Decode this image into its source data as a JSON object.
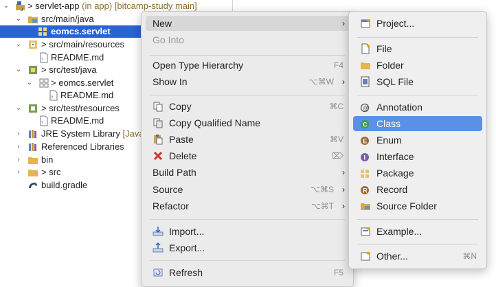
{
  "tree": {
    "project_name": "servlet-app",
    "project_suffix": " (in app) [bitcamp-study main]",
    "src_main_java": "src/main/java",
    "pkg_eomcs": "eomcs.servlet",
    "src_main_resources": "src/main/resources",
    "readme1": "README.md",
    "src_test_java": "src/test/java",
    "pkg_eomcs2": "eomcs.servlet",
    "readme2": "README.md",
    "src_test_resources": "src/test/resources",
    "readme3": "README.md",
    "jre": "JRE System Library",
    "jre_suffix": " [Java",
    "referenced": "Referenced Libraries",
    "bin": "bin",
    "src": "src",
    "gradle": "build.gradle",
    "twisty_open": "⌄",
    "twisty_closed": "›",
    "vcs_marker": ">"
  },
  "context_menu": {
    "new": "New",
    "go_into": "Go Into",
    "open_type_hierarchy": "Open Type Hierarchy",
    "open_type_hierarchy_sc": "F4",
    "show_in": "Show In",
    "show_in_sc": "⌥⌘W",
    "copy": "Copy",
    "copy_sc": "⌘C",
    "copy_qualified": "Copy Qualified Name",
    "paste": "Paste",
    "paste_sc": "⌘V",
    "delete": "Delete",
    "delete_sc": "⌦",
    "build_path": "Build Path",
    "source": "Source",
    "source_sc": "⌥⌘S",
    "refactor": "Refactor",
    "refactor_sc": "⌥⌘T",
    "import": "Import...",
    "export": "Export...",
    "refresh": "Refresh",
    "refresh_sc": "F5",
    "submenu_arrow": "›"
  },
  "new_submenu": {
    "project": "Project...",
    "file": "File",
    "folder": "Folder",
    "sql_file": "SQL File",
    "annotation": "Annotation",
    "class": "Class",
    "enum": "Enum",
    "interface": "Interface",
    "package": "Package",
    "record": "Record",
    "source_folder": "Source Folder",
    "example": "Example...",
    "other": "Other...",
    "other_sc": "⌘N"
  },
  "colors": {
    "selection": "#2a63d4",
    "submenu_highlight": "#5a91e6",
    "menu_bg": "#ebebeb"
  }
}
